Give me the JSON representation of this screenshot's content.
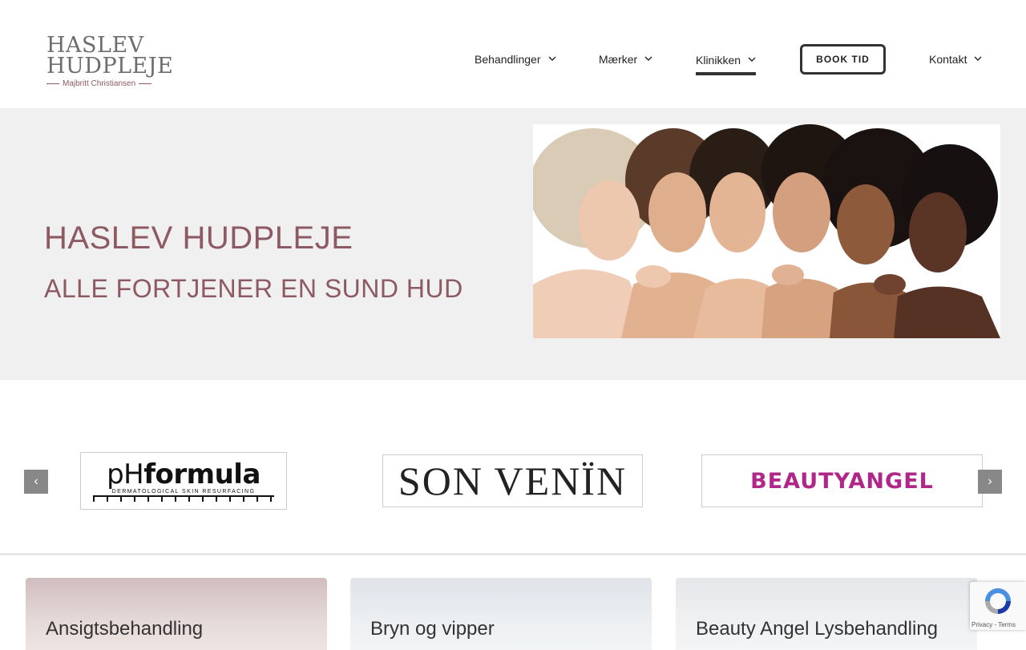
{
  "header": {
    "logo": {
      "line1": "HASLEV",
      "line2": "HUDPLEJE",
      "line3": "Majbritt Christiansen"
    },
    "nav": [
      {
        "label": "Behandlinger",
        "has_dropdown": true
      },
      {
        "label": "Mærker",
        "has_dropdown": true
      },
      {
        "label": "Klinikken",
        "has_dropdown": true,
        "active": true
      },
      {
        "label": "Kontakt",
        "has_dropdown": true
      }
    ],
    "book_button": "BOOK TID"
  },
  "hero": {
    "title": "HASLEV HUDPLEJE",
    "subtitle": "ALLE FORTJENER EN SUND HUD",
    "image": "group-of-women-photo"
  },
  "brands": {
    "prev_icon": "‹",
    "next_icon": "›",
    "items": [
      {
        "name_main": "pH",
        "name_bold": "formula",
        "tagline": "DERMATOLOGICAL SKIN RESURFACING"
      },
      {
        "name": "SON VENÏN"
      },
      {
        "name": "BEAUTYANGEL"
      }
    ]
  },
  "cards": [
    {
      "title": "Ansigtsbehandling"
    },
    {
      "title": "Bryn og vipper"
    },
    {
      "title": "Beauty Angel Lysbehandling"
    }
  ],
  "recaptcha": {
    "text": "Privacy - Terms"
  },
  "colors": {
    "brand_mauve": "#8d5a63",
    "hero_bg": "#f0f0f0",
    "beauty_angel": "#b0278a"
  }
}
